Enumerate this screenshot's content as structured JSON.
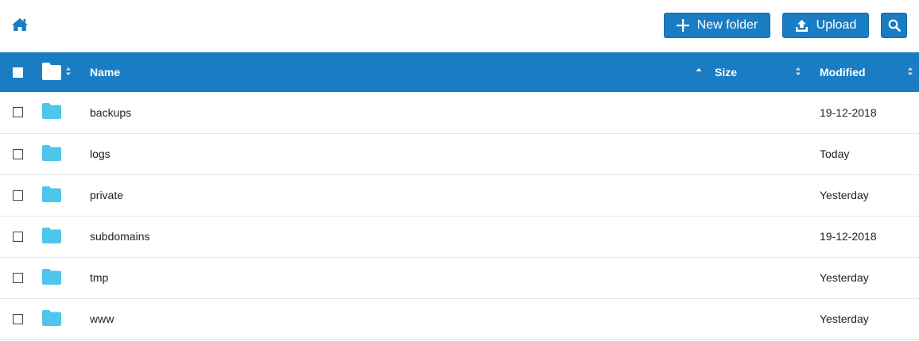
{
  "toolbar": {
    "home_icon": "home-icon",
    "new_folder_label": "New folder",
    "upload_label": "Upload",
    "search_icon": "search-icon",
    "accent_color": "#1a7dc3"
  },
  "table": {
    "header": {
      "name": "Name",
      "size": "Size",
      "modified": "Modified",
      "sort_column": "name",
      "sort_direction": "ascending"
    },
    "folder_color": "#4ec6ec",
    "rows": [
      {
        "name": "backups",
        "size": "",
        "modified": "19-12-2018"
      },
      {
        "name": "logs",
        "size": "",
        "modified": "Today"
      },
      {
        "name": "private",
        "size": "",
        "modified": "Yesterday"
      },
      {
        "name": "subdomains",
        "size": "",
        "modified": "19-12-2018"
      },
      {
        "name": "tmp",
        "size": "",
        "modified": "Yesterday"
      },
      {
        "name": "www",
        "size": "",
        "modified": "Yesterday"
      }
    ]
  }
}
